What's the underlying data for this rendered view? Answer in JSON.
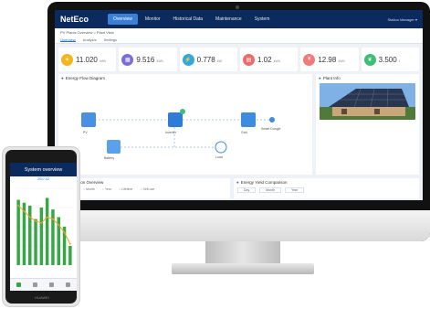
{
  "app": {
    "logo": "NetEco",
    "nav": [
      "Overview",
      "Monitor",
      "Historical Data",
      "Maintenance",
      "System"
    ],
    "active_nav": 0,
    "user": "Station Manager ▾",
    "breadcrumb": "PV Plants Overview > Plant View",
    "subtabs": [
      "Overview",
      "Analysis",
      "Settings"
    ]
  },
  "kpis": [
    {
      "value": "11.020",
      "unit": "kWh",
      "color": "#f2b51b",
      "icon": "sun-icon"
    },
    {
      "value": "9.516",
      "unit": "kWh",
      "color": "#7b6fd6",
      "icon": "panel-icon"
    },
    {
      "value": "0.778",
      "unit": "kW",
      "color": "#2fa9e0",
      "icon": "power-icon"
    },
    {
      "value": "1.02",
      "unit": "kWh",
      "color": "#ee6b6b",
      "icon": "meter-icon"
    },
    {
      "value": "12.98",
      "unit": "kWh",
      "color": "#f27a7a",
      "icon": "coin-icon"
    },
    {
      "value": "3.500",
      "unit": "t",
      "color": "#3fbf73",
      "icon": "leaf-icon"
    }
  ],
  "flow": {
    "title": "Energy Flow Diagram",
    "nodes": [
      "PV",
      "Inverter",
      "Grid",
      "Load",
      "Battery",
      "Smart Dongle"
    ]
  },
  "photo": {
    "title": "Plant Info"
  },
  "bottom": {
    "left_title": "Production Overview",
    "options": [
      "Daily",
      "Month",
      "Year",
      "Lifetime",
      "Self-use"
    ],
    "right_title": "Energy Yield Comparison",
    "right_tabs": [
      "Day",
      "Month",
      "Year"
    ]
  },
  "phone": {
    "title": "System overview",
    "subtitle": "2017-02",
    "brand": "HUAWEI"
  },
  "chart_data": {
    "type": "bar",
    "categories": [
      "1",
      "2",
      "3",
      "4",
      "5",
      "6",
      "7",
      "8",
      "9",
      "10"
    ],
    "series": [
      {
        "type": "bar",
        "values": [
          68,
          65,
          62,
          48,
          60,
          70,
          58,
          50,
          40,
          20
        ],
        "color": "#35a745"
      },
      {
        "type": "line",
        "values": [
          62,
          56,
          50,
          46,
          44,
          50,
          48,
          42,
          34,
          22
        ],
        "color": "#f2a31b"
      }
    ],
    "ylim": [
      0,
      80
    ]
  }
}
